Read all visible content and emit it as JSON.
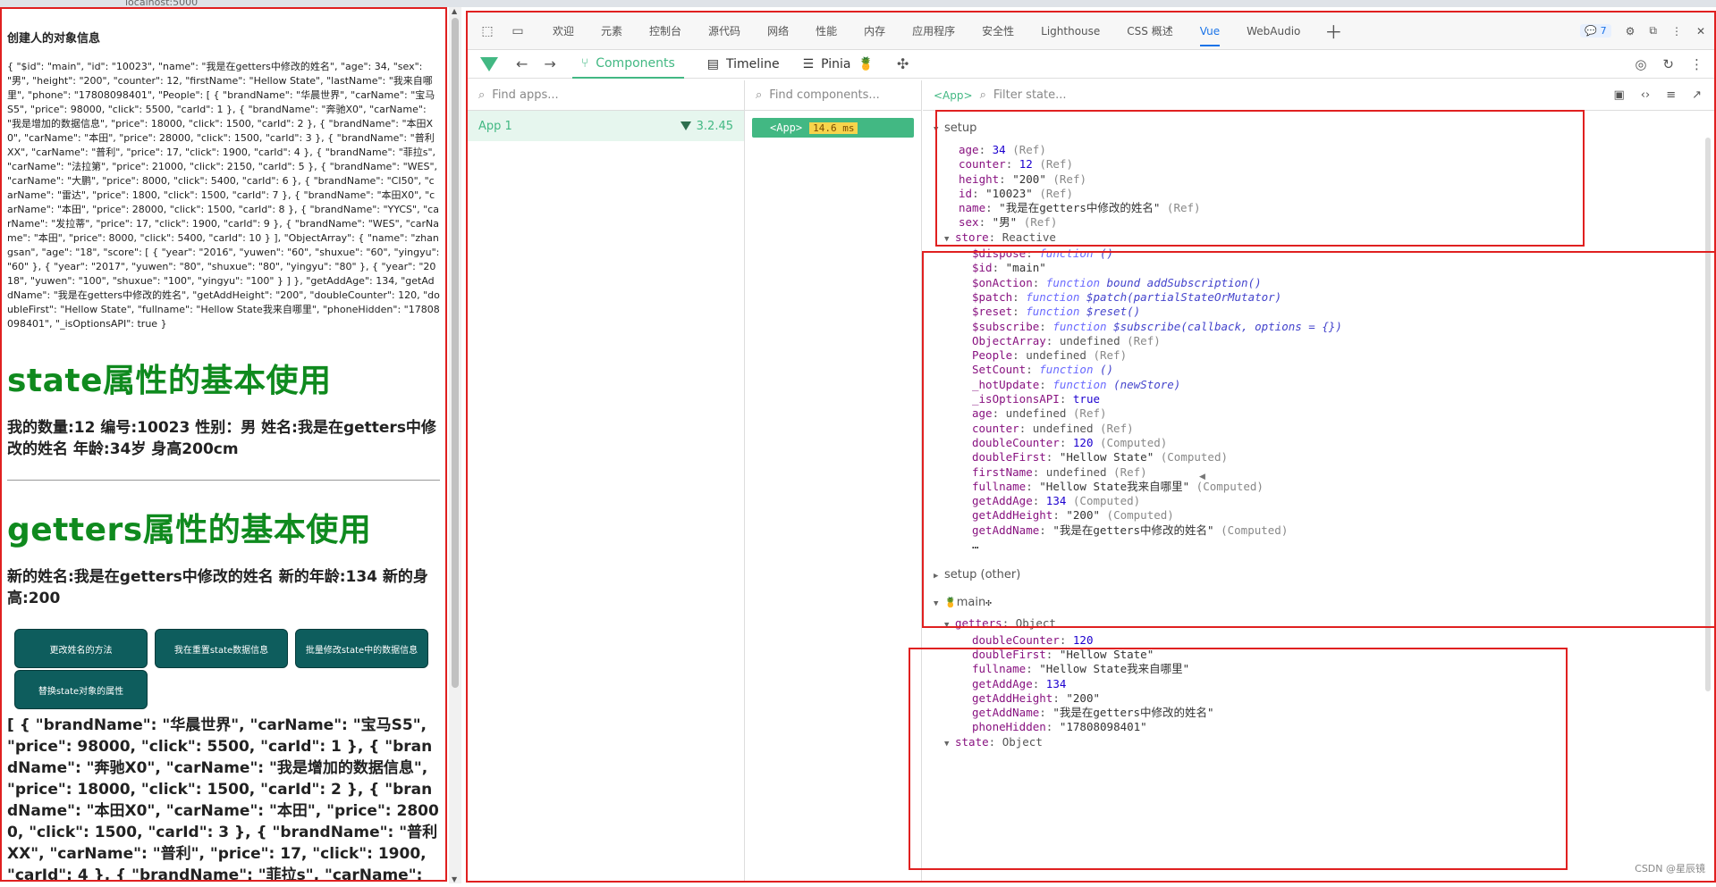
{
  "browser": {
    "url_fragment": "localhost:5000"
  },
  "page": {
    "small_heading": "创建人的对象信息",
    "object_json": "{ \"$id\": \"main\", \"id\": \"10023\", \"name\": \"我是在getters中修改的姓名\", \"age\": 34, \"sex\": \"男\", \"height\": \"200\", \"counter\": 12, \"firstName\": \"Hellow State\", \"lastName\": \"我来自哪里\", \"phone\": \"17808098401\", \"People\": [ { \"brandName\": \"华晨世界\", \"carName\": \"宝马S5\", \"price\": 98000, \"click\": 5500, \"carId\": 1 }, { \"brandName\": \"奔驰X0\", \"carName\": \"我是增加的数据信息\", \"price\": 18000, \"click\": 1500, \"carId\": 2 }, { \"brandName\": \"本田X0\", \"carName\": \"本田\", \"price\": 28000, \"click\": 1500, \"carId\": 3 }, { \"brandName\": \"普利XX\", \"carName\": \"普利\", \"price\": 17, \"click\": 1900, \"carId\": 4 }, { \"brandName\": \"菲拉s\", \"carName\": \"法拉第\", \"price\": 21000, \"click\": 2150, \"carId\": 5 }, { \"brandName\": \"WES\", \"carName\": \"大鹏\", \"price\": 8000, \"click\": 5400, \"carId\": 6 }, { \"brandName\": \"CI50\", \"carName\": \"雷达\", \"price\": 1800, \"click\": 1500, \"carId\": 7 }, { \"brandName\": \"本田X0\", \"carName\": \"本田\", \"price\": 28000, \"click\": 1500, \"carId\": 8 }, { \"brandName\": \"YYCS\", \"carName\": \"发拉蒂\", \"price\": 17, \"click\": 1900, \"carId\": 9 }, { \"brandName\": \"WES\", \"carName\": \"本田\", \"price\": 8000, \"click\": 5400, \"carId\": 10 } ], \"ObjectArray\": { \"name\": \"zhangsan\", \"age\": \"18\", \"score\": [ { \"year\": \"2016\", \"yuwen\": \"60\", \"shuxue\": \"60\", \"yingyu\": \"60\" }, { \"year\": \"2017\", \"yuwen\": \"80\", \"shuxue\": \"80\", \"yingyu\": \"80\" }, { \"year\": \"2018\", \"yuwen\": \"100\", \"shuxue\": \"100\", \"yingyu\": \"100\" } ] }, \"getAddAge\": 134, \"getAddName\": \"我是在getters中修改的姓名\", \"getAddHeight\": \"200\", \"doubleCounter\": 120, \"doubleFirst\": \"Hellow State\", \"fullname\": \"Hellow State我来自哪里\", \"phoneHidden\": \"17808098401\", \"_isOptionsAPI\": true }",
    "state_title": "state属性的基本使用",
    "state_info": "我的数量:12    编号:10023  性别：男    姓名:我是在getters中修改的姓名    年龄:34岁    身高200cm",
    "getters_title": "getters属性的基本使用",
    "getters_info": "新的姓名:我是在getters中修改的姓名    新的年龄:134    新的身高:200",
    "buttons": [
      "更改姓名的方法",
      "我在重置state数据信息",
      "批量修改state中的数据信息",
      "替换state对象的属性"
    ],
    "people_json": "[ { \"brandName\": \"华晨世界\", \"carName\": \"宝马S5\", \"price\": 98000, \"click\": 5500, \"carId\": 1 }, { \"brandName\": \"奔驰X0\", \"carName\": \"我是增加的数据信息\", \"price\": 18000, \"click\": 1500, \"carId\": 2 }, { \"brandName\": \"本田X0\", \"carName\": \"本田\", \"price\": 28000, \"click\": 1500, \"carId\": 3 }, { \"brandName\": \"普利XX\", \"carName\": \"普利\", \"price\": 17, \"click\": 1900, \"carId\": 4 }, { \"brandName\": \"菲拉s\", \"carName\": \"法拉"
  },
  "devtools": {
    "tabs": [
      "欢迎",
      "元素",
      "控制台",
      "源代码",
      "网络",
      "性能",
      "内存",
      "应用程序",
      "安全性",
      "Lighthouse",
      "CSS 概述",
      "Vue",
      "WebAudio"
    ],
    "active_tab": "Vue",
    "issues_count": "7",
    "vue_tabs": [
      "Components",
      "Timeline",
      "Pinia"
    ],
    "find_apps_placeholder": "Find apps...",
    "find_components_placeholder": "Find components...",
    "filter_state_placeholder": "Filter state...",
    "app_tag": "<App>",
    "app_name": "App 1",
    "vue_version": "3.2.45",
    "component_name": "<App>",
    "component_time": "14.6 ms",
    "setup_label": "setup",
    "setup_rows": [
      {
        "k": "age",
        "v": "34",
        "vt": "n",
        "t": "(Ref)"
      },
      {
        "k": "counter",
        "v": "12",
        "vt": "n",
        "t": "(Ref)"
      },
      {
        "k": "height",
        "v": "\"200\"",
        "vt": "s",
        "t": "(Ref)"
      },
      {
        "k": "id",
        "v": "\"10023\"",
        "vt": "s",
        "t": "(Ref)"
      },
      {
        "k": "name",
        "v": "\"我是在getters中修改的姓名\"",
        "vt": "s",
        "t": "(Ref)"
      },
      {
        "k": "sex",
        "v": "\"男\"",
        "vt": "s",
        "t": "(Ref)"
      }
    ],
    "store_label": "store",
    "store_type": "Reactive",
    "store_rows": [
      {
        "k": "$dispose",
        "kw": "function",
        "v": "()"
      },
      {
        "k": "$id",
        "v": "\"main\"",
        "vt": "s"
      },
      {
        "k": "$onAction",
        "kw": "function",
        "v": "bound addSubscription()"
      },
      {
        "k": "$patch",
        "kw": "function",
        "v": "$patch(partialStateOrMutator)"
      },
      {
        "k": "$reset",
        "kw": "function",
        "v": "$reset()"
      },
      {
        "k": "$subscribe",
        "kw": "function",
        "v": "$subscribe(callback, options = {})"
      },
      {
        "k": "ObjectArray",
        "v": "undefined",
        "vt": "plain",
        "t": "(Ref)"
      },
      {
        "k": "People",
        "v": "undefined",
        "vt": "plain",
        "t": "(Ref)"
      },
      {
        "k": "SetCount",
        "kw": "function",
        "v": "()"
      },
      {
        "k": "_hotUpdate",
        "kw": "function",
        "v": "(newStore)"
      },
      {
        "k": "_isOptionsAPI",
        "v": "true",
        "vt": "bool"
      },
      {
        "k": "age",
        "v": "undefined",
        "vt": "plain",
        "t": "(Ref)"
      },
      {
        "k": "counter",
        "v": "undefined",
        "vt": "plain",
        "t": "(Ref)"
      },
      {
        "k": "doubleCounter",
        "v": "120",
        "vt": "n",
        "t": "(Computed)"
      },
      {
        "k": "doubleFirst",
        "v": "\"Hellow State\"",
        "vt": "s",
        "t": "(Computed)"
      },
      {
        "k": "firstName",
        "v": "undefined",
        "vt": "plain",
        "t": "(Ref)"
      },
      {
        "k": "fullname",
        "v": "\"Hellow State我来自哪里\"",
        "vt": "s",
        "t": "(Computed)"
      },
      {
        "k": "getAddAge",
        "v": "134",
        "vt": "n",
        "t": "(Computed)"
      },
      {
        "k": "getAddHeight",
        "v": "\"200\"",
        "vt": "s",
        "t": "(Computed)"
      },
      {
        "k": "getAddName",
        "v": "\"我是在getters中修改的姓名\"",
        "vt": "s",
        "t": "(Computed)"
      }
    ],
    "ellipsis": "…",
    "setup_other_label": "setup (other)",
    "main_label": "main",
    "getters_label": "getters",
    "getters_type": "Object",
    "getters_rows": [
      {
        "k": "doubleCounter",
        "v": "120",
        "vt": "n"
      },
      {
        "k": "doubleFirst",
        "v": "\"Hellow State\"",
        "vt": "s"
      },
      {
        "k": "fullname",
        "v": "\"Hellow State我来自哪里\"",
        "vt": "s"
      },
      {
        "k": "getAddAge",
        "v": "134",
        "vt": "n"
      },
      {
        "k": "getAddHeight",
        "v": "\"200\"",
        "vt": "s"
      },
      {
        "k": "getAddName",
        "v": "\"我是在getters中修改的姓名\"",
        "vt": "s"
      },
      {
        "k": "phoneHidden",
        "v": "\"17808098401\"",
        "vt": "s"
      }
    ],
    "state_label": "state",
    "state_type": "Object"
  },
  "watermark": "CSDN @星辰镜"
}
